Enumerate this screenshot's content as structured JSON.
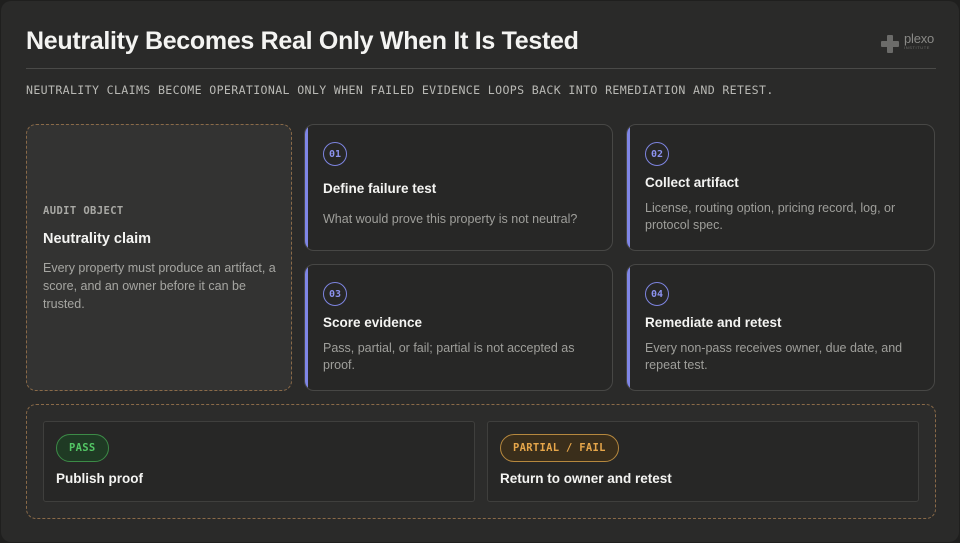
{
  "header": {
    "title": "Neutrality Becomes Real Only When It Is Tested",
    "subtitle": "NEUTRALITY CLAIMS BECOME OPERATIONAL ONLY WHEN FAILED EVIDENCE LOOPS BACK INTO REMEDIATION AND RETEST.",
    "logo_name": "plexo",
    "logo_sub": "INSTITUTE"
  },
  "claim": {
    "eyebrow": "AUDIT OBJECT",
    "title": "Neutrality claim",
    "body": "Every property must produce an artifact, a score, and an owner before it can be trusted."
  },
  "steps": [
    {
      "number": "01",
      "title": "Define failure test",
      "body": "What would prove this property is not neutral?"
    },
    {
      "number": "02",
      "title": "Collect artifact",
      "body": "License, routing option, pricing record, log, or protocol spec."
    },
    {
      "number": "03",
      "title": "Score evidence",
      "body": "Pass, partial, or fail; partial is not accepted as proof."
    },
    {
      "number": "04",
      "title": "Remediate and retest",
      "body": "Every non-pass receives owner, due date, and repeat test."
    }
  ],
  "outcomes": [
    {
      "badge": "PASS",
      "title": "Publish proof"
    },
    {
      "badge": "PARTIAL / FAIL",
      "title": "Return to owner and retest"
    }
  ],
  "colors": {
    "accent": "#7f86e6",
    "pass": "#53c765",
    "fail": "#e6a64a",
    "dashed_border": "#8a6a48"
  }
}
